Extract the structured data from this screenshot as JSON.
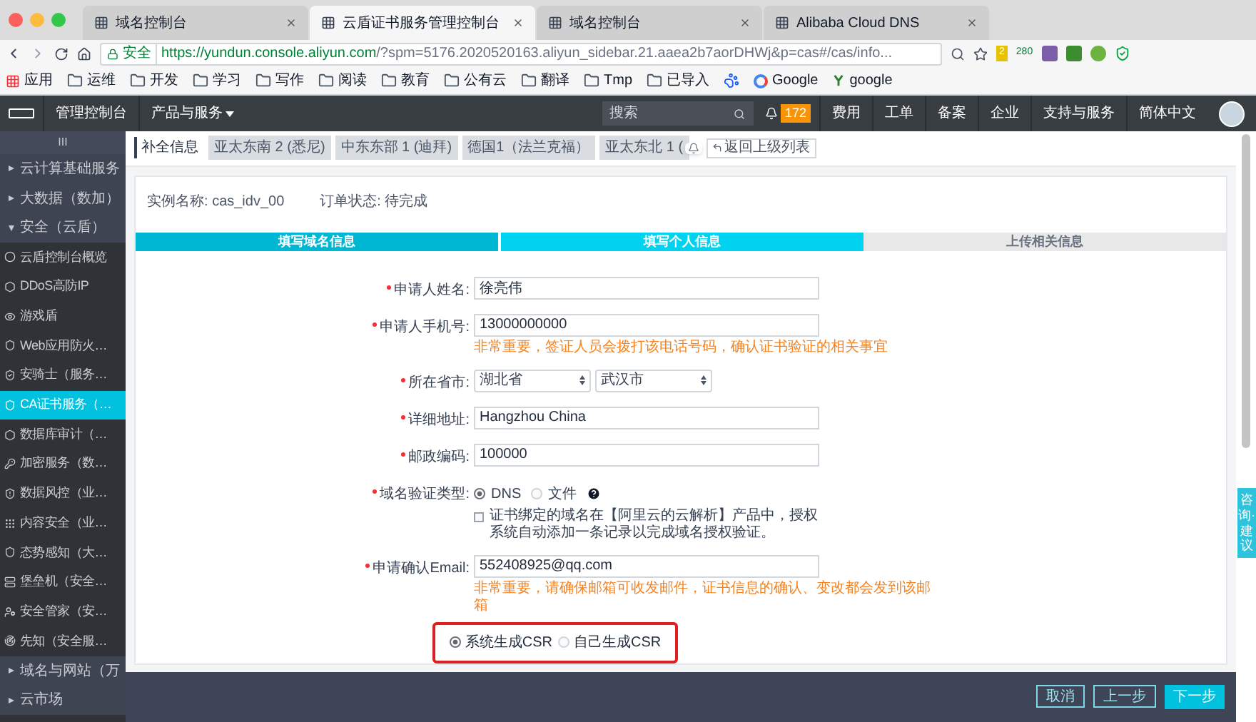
{
  "browser_tabs": [
    {
      "title": "域名控制台",
      "selected": false
    },
    {
      "title": "云盾证书服务管理控制台",
      "selected": true
    },
    {
      "title": "域名控制台",
      "selected": false
    },
    {
      "title": "Alibaba Cloud DNS",
      "selected": false
    }
  ],
  "address_bar": {
    "secure_label": "安全",
    "url_host": "https://yundun.console.aliyun.com",
    "url_rest": "/?spm=5176.2020520163.aliyun_sidebar.21.aaea2b7aorDHWj&p=cas#/cas/info..."
  },
  "extension_badges": [
    "2",
    "280"
  ],
  "bookmarks": [
    {
      "label": "应用",
      "kind": "apps"
    },
    {
      "label": "运维",
      "kind": "folder"
    },
    {
      "label": "开发",
      "kind": "folder"
    },
    {
      "label": "学习",
      "kind": "folder"
    },
    {
      "label": "写作",
      "kind": "folder"
    },
    {
      "label": "阅读",
      "kind": "folder"
    },
    {
      "label": "教育",
      "kind": "folder"
    },
    {
      "label": "公有云",
      "kind": "folder"
    },
    {
      "label": "翻译",
      "kind": "folder"
    },
    {
      "label": "Tmp",
      "kind": "folder"
    },
    {
      "label": "已导入",
      "kind": "folder"
    },
    {
      "kind": "paw"
    },
    {
      "label": "Google",
      "kind": "google"
    },
    {
      "label": "google",
      "kind": "y"
    }
  ],
  "header": {
    "console": "管理控制台",
    "products": "产品与服务",
    "search_placeholder": "搜索",
    "notification_count": "172",
    "menu": [
      "费用",
      "工单",
      "备案",
      "企业",
      "支持与服务",
      "简体中文"
    ]
  },
  "sidebar": {
    "handle": "III",
    "groups": [
      {
        "label": "云计算基础服务",
        "expanded": false
      },
      {
        "label": "大数据（数加）",
        "expanded": false
      },
      {
        "label": "安全（云盾）",
        "expanded": true,
        "children": [
          {
            "label": "云盾控制台概览",
            "selected": false
          },
          {
            "label": "DDoS高防IP",
            "selected": false
          },
          {
            "label": "游戏盾",
            "selected": false
          },
          {
            "label": "Web应用防火…",
            "selected": false
          },
          {
            "label": "安骑士（服务…",
            "selected": false
          },
          {
            "label": "CA证书服务（…",
            "selected": true
          },
          {
            "label": "数据库审计（…",
            "selected": false
          },
          {
            "label": "加密服务（数…",
            "selected": false
          },
          {
            "label": "数据风控（业…",
            "selected": false
          },
          {
            "label": "内容安全（业…",
            "selected": false
          },
          {
            "label": "态势感知（大…",
            "selected": false
          },
          {
            "label": "堡垒机（安全…",
            "selected": false
          },
          {
            "label": "安全管家（安…",
            "selected": false
          },
          {
            "label": "先知（安全服…",
            "selected": false
          }
        ]
      },
      {
        "label": "域名与网站（万",
        "expanded": false
      },
      {
        "label": "云市场",
        "expanded": false
      }
    ]
  },
  "page_tabs": {
    "title": "补全信息",
    "regions": [
      "亚太东南 2 (悉尼)",
      "中东东部 1 (迪拜)",
      "德国1（法兰克福）",
      "亚太东北 1 ("
    ],
    "back": "返回上级列表"
  },
  "instance": {
    "name_label": "实例名称:",
    "name": "cas_idv_00",
    "status_label": "订单状态:",
    "status": "待完成"
  },
  "steps": [
    {
      "label": "填写域名信息",
      "done": true,
      "selected": false
    },
    {
      "label": "填写个人信息",
      "done": false,
      "selected": true
    },
    {
      "label": "上传相关信息",
      "done": false,
      "selected": false
    }
  ],
  "form": [
    {
      "kind": "input",
      "label": "申请人姓名:",
      "required": true,
      "value": "徐亮伟"
    },
    {
      "kind": "input",
      "label": "申请人手机号:",
      "required": true,
      "value": "13000000000",
      "hint": "非常重要，签证人员会拨打该电话号码，确认证书验证的相关事宜"
    },
    {
      "kind": "selects",
      "label": "所在省市:",
      "required": true,
      "values": [
        "湖北省",
        "武汉市"
      ]
    },
    {
      "kind": "input",
      "label": "详细地址:",
      "required": true,
      "value": "Hangzhou China"
    },
    {
      "kind": "input",
      "label": "邮政编码:",
      "required": true,
      "value": "100000"
    },
    {
      "kind": "radios",
      "label": "域名验证类型:",
      "required": true,
      "options": [
        {
          "label": "DNS",
          "selected": true
        },
        {
          "label": "文件",
          "selected": false
        }
      ],
      "checkbox": {
        "label": "证书绑定的域名在【阿里云的云解析】产品中，授权系统自动添加一条记录以完成域名授权验证。",
        "checked": false
      }
    },
    {
      "kind": "input",
      "label": "申请确认Email:",
      "required": true,
      "value": "552408925@qq.com",
      "hint": "非常重要，请确保邮箱可收发邮件，证书信息的确认、变改都会发到该邮箱"
    }
  ],
  "csr": [
    {
      "label": "系统生成CSR",
      "selected": true
    },
    {
      "label": "自己生成CSR",
      "selected": false
    }
  ],
  "buttons": [
    {
      "label": "取消",
      "kind": "outline"
    },
    {
      "label": "上一步",
      "kind": "outline"
    },
    {
      "label": "下一步",
      "kind": "primary"
    }
  ],
  "feedback_tab": "咨询·建议"
}
